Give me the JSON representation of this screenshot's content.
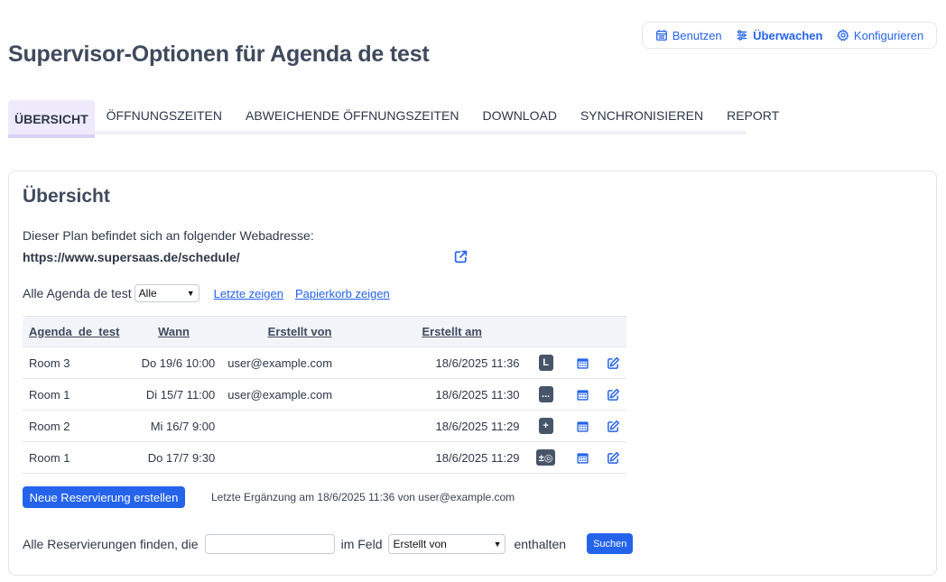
{
  "topnav": {
    "items": [
      {
        "label": "Benutzen",
        "icon": "calendar-icon"
      },
      {
        "label": "Überwachen",
        "icon": "sliders-icon",
        "active": true
      },
      {
        "label": "Konfigurieren",
        "icon": "gear-icon"
      }
    ]
  },
  "title": "Supervisor-Optionen für Agenda de test",
  "tabs": [
    {
      "label": "Übersicht",
      "active": true
    },
    {
      "label": "Öffnungszeiten"
    },
    {
      "label": "Abweichende Öffnungszeiten"
    },
    {
      "label": "Download"
    },
    {
      "label": "Synchronisieren"
    },
    {
      "label": "Report"
    }
  ],
  "overview": {
    "heading": "Übersicht",
    "address_text": "Dieser Plan befindet sich an folgender Webadresse:",
    "address_url": "https://www.supersaas.de/schedule/",
    "filter_label": "Alle Agenda de test",
    "filter_value": "Alle",
    "link_recent": "Letzte zeigen",
    "link_trash": "Papierkorb zeigen"
  },
  "table": {
    "headers": {
      "resource": "Agenda_de_test",
      "when": "Wann",
      "created_by": "Erstellt von",
      "created_at": "Erstellt am"
    },
    "rows": [
      {
        "resource": "Room 3",
        "when": "Do 19/6 10:00",
        "created_by": "user@example.com",
        "created_at": "18/6/2025 11:36",
        "badge": "L"
      },
      {
        "resource": "Room 1",
        "when": "Di 15/7 11:00",
        "created_by": "user@example.com",
        "created_at": "18/6/2025 11:30",
        "badge": "..."
      },
      {
        "resource": "Room 2",
        "when": "Mi 16/7 9:00",
        "created_by": "",
        "created_at": "18/6/2025 11:29",
        "badge": "+"
      },
      {
        "resource": "Room 1",
        "when": "Do 17/7 9:30",
        "created_by": "",
        "created_at": "18/6/2025 11:29",
        "badge": "±◎"
      }
    ]
  },
  "new_button": "Neue Reservierung erstellen",
  "last_added": "Letzte Ergänzung am 18/6/2025 11:36 von user@example.com",
  "search": {
    "prefix": "Alle Reservierungen finden, die",
    "input_value": "",
    "field_label": "im Feld",
    "field_value": "Erstellt von",
    "suffix": "enthalten",
    "button": "Suchen"
  },
  "colors": {
    "accent": "#2563eb",
    "badge": "#475569",
    "tab_active_bg": "#eeeafc"
  }
}
